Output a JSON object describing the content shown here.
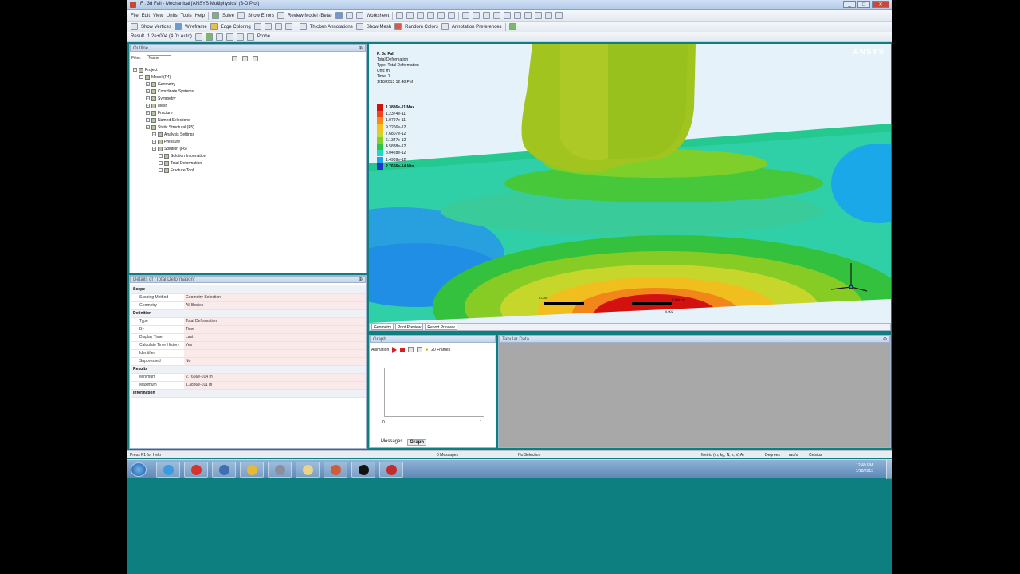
{
  "window": {
    "title": "F : 3d Fall - Mechanical [ANSYS Multiphysics] (3-D Plot)",
    "controls": [
      "_",
      "□",
      "✕"
    ]
  },
  "menu": {
    "items": [
      "File",
      "Edit",
      "View",
      "Units",
      "Tools",
      "Help"
    ],
    "buttons": [
      "Solve",
      "Show Errors",
      "Review Model (Beta)",
      "Worksheet"
    ]
  },
  "toolbar2": {
    "items": [
      "Show Vertices",
      "Wireframe",
      "Edge Coloring",
      "Thicken Annotations",
      "Show Mesh",
      "Random Colors",
      "Annotation Preferences"
    ]
  },
  "toolbar3": {
    "result_label": "Result",
    "scale_value": "1.2e+004 (4.0x Auto)",
    "probe": "Probe"
  },
  "outline": {
    "title": "Outline",
    "filter_label": "Filter:",
    "filter_value": "Name",
    "tree": [
      {
        "label": "Project",
        "depth": 0
      },
      {
        "label": "Model (F4)",
        "depth": 1
      },
      {
        "label": "Geometry",
        "depth": 2
      },
      {
        "label": "Coordinate Systems",
        "depth": 2
      },
      {
        "label": "Symmetry",
        "depth": 2
      },
      {
        "label": "Mesh",
        "depth": 2
      },
      {
        "label": "Fracture",
        "depth": 2
      },
      {
        "label": "Named Selections",
        "depth": 2
      },
      {
        "label": "Static Structural (F5)",
        "depth": 2
      },
      {
        "label": "Analysis Settings",
        "depth": 3
      },
      {
        "label": "Pressure",
        "depth": 3
      },
      {
        "label": "Solution (F6)",
        "depth": 3
      },
      {
        "label": "Solution Information",
        "depth": 4
      },
      {
        "label": "Total Deformation",
        "depth": 4
      },
      {
        "label": "Fracture Tool",
        "depth": 4
      }
    ]
  },
  "details": {
    "title": "Details of \"Total Deformation\"",
    "sections": [
      {
        "name": "Scope",
        "rows": [
          {
            "k": "Scoping Method",
            "v": "Geometry Selection"
          },
          {
            "k": "Geometry",
            "v": "All Bodies"
          }
        ]
      },
      {
        "name": "Definition",
        "rows": [
          {
            "k": "Type",
            "v": "Total Deformation"
          },
          {
            "k": "By",
            "v": "Time"
          },
          {
            "k": "Display Time",
            "v": "Last"
          },
          {
            "k": "Calculate Time History",
            "v": "Yes"
          },
          {
            "k": "Identifier",
            "v": ""
          },
          {
            "k": "Suppressed",
            "v": "No"
          }
        ]
      },
      {
        "name": "Results",
        "rows": [
          {
            "k": "Minimum",
            "v": "2.7666e-014 m"
          },
          {
            "k": "Maximum",
            "v": "1.3886e-011 m"
          }
        ]
      },
      {
        "name": "Information",
        "rows": []
      }
    ]
  },
  "viewport": {
    "info": [
      "F: 3d Fall",
      "Total Deformation",
      "Type: Total Deformation",
      "Unit: m",
      "Time: 1",
      "1/18/2013 12:48 PM"
    ],
    "legend": [
      {
        "label": "1.3886e-11 Max",
        "color": "#d3120f",
        "bold": true
      },
      {
        "label": "1.2374e-11",
        "color": "#f1461a"
      },
      {
        "label": "1.0797e-11",
        "color": "#f78a18"
      },
      {
        "label": "9.2266e-12",
        "color": "#f4c21d"
      },
      {
        "label": "7.6807e-12",
        "color": "#c9d82a"
      },
      {
        "label": "6.1347e-12",
        "color": "#83cf2c"
      },
      {
        "label": "4.5888e-12",
        "color": "#2fc34a"
      },
      {
        "label": "3.0428e-12",
        "color": "#1fd8c0"
      },
      {
        "label": "1.4969e-12",
        "color": "#1f9ff0"
      },
      {
        "label": "2.7666e-14 Min",
        "color": "#1b36c8",
        "bold": true
      }
    ],
    "brand": "ANSYS",
    "brand_version": "R14.5",
    "scale_left": "0.000",
    "scale_right": "0.004 (m)",
    "scale_mid": "0.002"
  },
  "viewport_tabs": [
    "Geometry",
    "Print Preview",
    "Report Preview"
  ],
  "graph": {
    "title": "Graph",
    "animation_label": "Animation",
    "frames": "20 Frames",
    "axis_min": "0",
    "axis_max": "1",
    "tabs": [
      "Messages",
      "Graph"
    ]
  },
  "tabular": {
    "title": "Tabular Data"
  },
  "status": {
    "help": "Press F1 for Help",
    "messages": "0 Messages",
    "selection": "No Selection",
    "units": "Metric (m, kg, N, s, V, A)",
    "degrees": "Degrees",
    "rad": "rad/s",
    "celsius": "Celsius"
  },
  "taskbar": {
    "time": "12:49 PM",
    "date": "1/18/2013",
    "apps": [
      "#3a9be0",
      "#d8322c",
      "#3f6fb0",
      "#e7b934",
      "#8a8fa0",
      "#e9d48a",
      "#d25c3a",
      "#111111",
      "#c42b2b"
    ]
  }
}
